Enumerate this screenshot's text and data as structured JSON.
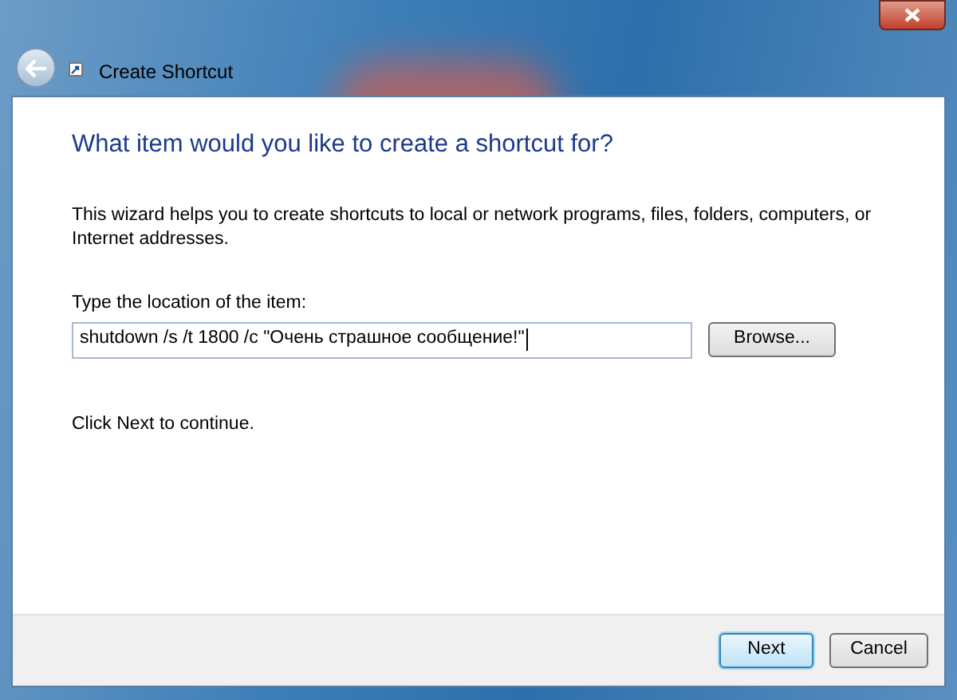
{
  "window": {
    "title": "Create Shortcut"
  },
  "heading": "What item would you like to create a shortcut for?",
  "description": "This wizard helps you to create shortcuts to local or network programs, files, folders, computers, or Internet addresses.",
  "location": {
    "label": "Type the location of the item:",
    "value": "shutdown /s /t 1800 /c \"Очень страшное сообщение!\"",
    "focused": true
  },
  "browse_button": "Browse...",
  "hint": "Click Next to continue.",
  "buttons": [
    {
      "label": "Next",
      "default": true
    },
    {
      "label": "Cancel",
      "default": false
    }
  ]
}
